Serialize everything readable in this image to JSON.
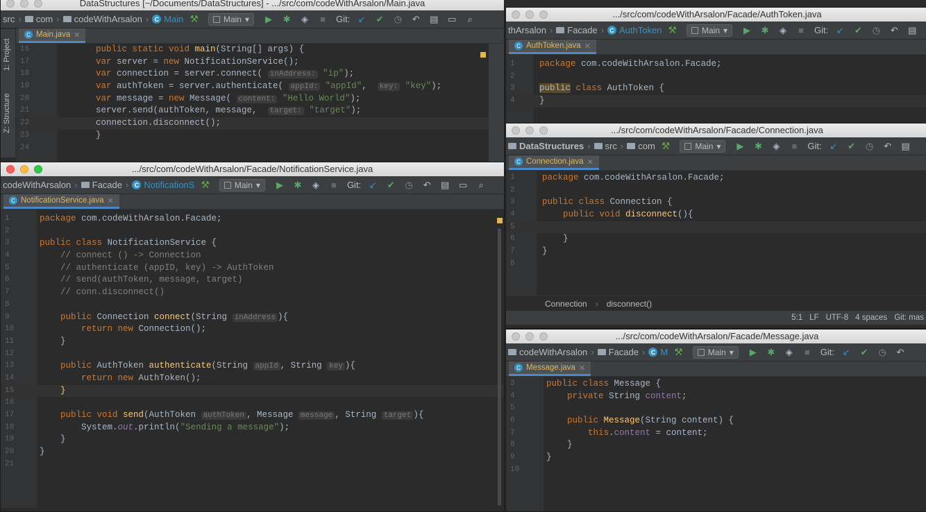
{
  "main_window": {
    "title": "DataStructures [~/Documents/DataStructures] - .../src/com/codeWithArsalon/Main.java",
    "breadcrumbs": [
      "src",
      "com",
      "codeWithArsalon",
      "Main"
    ],
    "run_config": "Main",
    "git_label": "Git:",
    "tab": "Main.java",
    "side_tabs": [
      "1: Project",
      "Z: Structure"
    ],
    "lines": [
      "16",
      "17",
      "18",
      "19",
      "20",
      "21",
      "22",
      "23",
      "24"
    ]
  },
  "notif_window": {
    "title": ".../src/com/codeWithArsalon/Facade/NotificationService.java",
    "breadcrumbs": [
      "codeWithArsalon",
      "Facade",
      "NotificationS"
    ],
    "run_config": "Main",
    "git_label": "Git:",
    "tab": "NotificationService.java",
    "lines": [
      "1",
      "2",
      "3",
      "4",
      "5",
      "6",
      "7",
      "8",
      "9",
      "10",
      "11",
      "12",
      "13",
      "14",
      "15",
      "16",
      "17",
      "18",
      "19",
      "20",
      "21"
    ]
  },
  "auth_window": {
    "title": ".../src/com/codeWithArsalon/Facade/AuthToken.java",
    "breadcrumbs": [
      "thArsalon",
      "Facade",
      "AuthToken"
    ],
    "run_config": "Main",
    "git_label": "Git:",
    "tab": "AuthToken.java",
    "lines": [
      "1",
      "2",
      "3",
      "4"
    ]
  },
  "conn_window": {
    "title": ".../src/com/codeWithArsalon/Facade/Connection.java",
    "breadcrumbs": [
      "DataStructures",
      "src",
      "com"
    ],
    "run_config": "Main",
    "git_label": "Git:",
    "tab": "Connection.java",
    "lines": [
      "1",
      "2",
      "3",
      "4",
      "5",
      "6",
      "7",
      "8"
    ],
    "code_breadcrumb": [
      "Connection",
      "disconnect()"
    ],
    "status": [
      "5:1",
      "LF",
      "UTF-8",
      "4 spaces",
      "Git: mas"
    ]
  },
  "msg_window": {
    "title": ".../src/com/codeWithArsalon/Facade/Message.java",
    "breadcrumbs": [
      "codeWithArsalon",
      "Facade",
      "M"
    ],
    "run_config": "Main",
    "git_label": "Git:",
    "tab": "Message.java",
    "lines": [
      "3",
      "4",
      "5",
      "6",
      "7",
      "8",
      "9",
      "10"
    ]
  },
  "code": {
    "main": [
      {
        "t": [
          [
            "kw",
            "public static void "
          ],
          [
            "fn",
            "main"
          ],
          [
            "",
            "(String[] args) {"
          ]
        ]
      },
      {
        "t": [
          [
            "kw",
            "var "
          ],
          [
            "",
            "server = "
          ],
          [
            "kw",
            "new "
          ],
          [
            "",
            "NotificationService();"
          ]
        ]
      },
      {
        "t": [
          [
            "kw",
            "var "
          ],
          [
            "",
            "connection = server.connect( "
          ],
          [
            "param",
            "inAddress:"
          ],
          [
            "str",
            " \"ip\""
          ],
          [
            "",
            ");"
          ]
        ]
      },
      {
        "t": [
          [
            "kw",
            "var "
          ],
          [
            "",
            "authToken = server.authenticate( "
          ],
          [
            "param",
            "appId:"
          ],
          [
            "str",
            " \"appId\""
          ],
          [
            "",
            ",  "
          ],
          [
            "param",
            "key:"
          ],
          [
            "str",
            " \"key\""
          ],
          [
            "",
            ");"
          ]
        ]
      },
      {
        "t": [
          [
            "kw",
            "var "
          ],
          [
            "",
            "message = "
          ],
          [
            "kw",
            "new "
          ],
          [
            "",
            "Message( "
          ],
          [
            "param",
            "content:"
          ],
          [
            "str",
            " \"Hello World\""
          ],
          [
            "",
            ");"
          ]
        ]
      },
      {
        "t": [
          [
            "",
            "server.send(authToken, message,  "
          ],
          [
            "param",
            "target:"
          ],
          [
            "str",
            " \"target\""
          ],
          [
            "",
            ");"
          ]
        ]
      },
      {
        "t": [
          [
            "",
            "connection.disconnect();"
          ]
        ]
      },
      {
        "t": [
          [
            "",
            "}"
          ]
        ]
      },
      {
        "t": []
      }
    ],
    "notif": [
      {
        "t": [
          [
            "kw",
            "package "
          ],
          [
            "",
            "com.codeWithArsalon.Facade;"
          ]
        ]
      },
      {
        "t": []
      },
      {
        "t": [
          [
            "kw",
            "public class "
          ],
          [
            "",
            "NotificationService {"
          ]
        ]
      },
      {
        "t": [
          [
            "cm",
            "    // connect () -> Connection"
          ]
        ]
      },
      {
        "t": [
          [
            "cm",
            "    // authenticate (appID, key) -> AuthToken"
          ]
        ]
      },
      {
        "t": [
          [
            "cm",
            "    // send(authToken, message, target)"
          ]
        ]
      },
      {
        "t": [
          [
            "cm",
            "    // conn.disconnect()"
          ]
        ]
      },
      {
        "t": []
      },
      {
        "t": [
          [
            "kw",
            "    public "
          ],
          [
            "",
            "Connection "
          ],
          [
            "fn",
            "connect"
          ],
          [
            "",
            "(String "
          ],
          [
            "param",
            "inAddress"
          ],
          [
            "",
            "){"
          ]
        ]
      },
      {
        "t": [
          [
            "kw",
            "        return new "
          ],
          [
            "",
            "Connection();"
          ]
        ]
      },
      {
        "t": [
          [
            "",
            "    }"
          ]
        ]
      },
      {
        "t": []
      },
      {
        "t": [
          [
            "kw",
            "    public "
          ],
          [
            "",
            "AuthToken "
          ],
          [
            "fn",
            "authenticate"
          ],
          [
            "",
            "(String "
          ],
          [
            "param",
            "appId"
          ],
          [
            "",
            ", String "
          ],
          [
            "param",
            "key"
          ],
          [
            "",
            "){"
          ]
        ]
      },
      {
        "t": [
          [
            "kw",
            "        return new "
          ],
          [
            "",
            "AuthToken();"
          ]
        ]
      },
      {
        "t": [
          [
            "fn",
            "    }"
          ]
        ]
      },
      {
        "t": []
      },
      {
        "t": [
          [
            "kw",
            "    public void "
          ],
          [
            "fn",
            "send"
          ],
          [
            "",
            "(AuthToken "
          ],
          [
            "param",
            "authToken"
          ],
          [
            "",
            ", Message "
          ],
          [
            "param",
            "message"
          ],
          [
            "",
            ", String "
          ],
          [
            "param",
            "target"
          ],
          [
            "",
            "){"
          ]
        ]
      },
      {
        "t": [
          [
            "",
            "        System."
          ],
          [
            "ital",
            "out"
          ],
          [
            "",
            ".println("
          ],
          [
            "str",
            "\"Sending a message\""
          ],
          [
            "",
            ");"
          ]
        ]
      },
      {
        "t": [
          [
            "",
            "    }"
          ]
        ]
      },
      {
        "t": [
          [
            "",
            "}"
          ]
        ]
      },
      {
        "t": []
      }
    ],
    "auth": [
      {
        "t": [
          [
            "kw",
            "package "
          ],
          [
            "",
            "com.codeWithArsalon.Facade;"
          ]
        ]
      },
      {
        "t": []
      },
      {
        "t": [
          [
            "hl-pub",
            "public"
          ],
          [
            "kw",
            " class "
          ],
          [
            "",
            "AuthToken {"
          ]
        ]
      },
      {
        "t": [
          [
            "",
            "}"
          ]
        ]
      }
    ],
    "conn": [
      {
        "t": [
          [
            "kw",
            "package "
          ],
          [
            "",
            "com.codeWithArsalon.Facade;"
          ]
        ]
      },
      {
        "t": []
      },
      {
        "t": [
          [
            "kw",
            "public class "
          ],
          [
            "",
            "Connection {"
          ]
        ]
      },
      {
        "t": [
          [
            "kw",
            "    public void "
          ],
          [
            "fn",
            "disconnect"
          ],
          [
            "",
            "(){"
          ]
        ]
      },
      {
        "t": []
      },
      {
        "t": [
          [
            "",
            "    }"
          ]
        ]
      },
      {
        "t": [
          [
            "",
            "}"
          ]
        ]
      },
      {
        "t": []
      }
    ],
    "msg": [
      {
        "t": [
          [
            "kw",
            "public class "
          ],
          [
            "",
            "Message {"
          ]
        ]
      },
      {
        "t": [
          [
            "kw",
            "    private "
          ],
          [
            "",
            "String "
          ],
          [
            "fld",
            "content"
          ],
          [
            "",
            ";"
          ]
        ]
      },
      {
        "t": []
      },
      {
        "t": [
          [
            "kw",
            "    public "
          ],
          [
            "fn",
            "Message"
          ],
          [
            "",
            "(String content) {"
          ]
        ]
      },
      {
        "t": [
          [
            "kw",
            "        this"
          ],
          [
            "",
            "."
          ],
          [
            "fld",
            "content"
          ],
          [
            "",
            " = content;"
          ]
        ]
      },
      {
        "t": [
          [
            "",
            "    }"
          ]
        ]
      },
      {
        "t": [
          [
            "",
            "}"
          ]
        ]
      },
      {
        "t": []
      }
    ]
  }
}
